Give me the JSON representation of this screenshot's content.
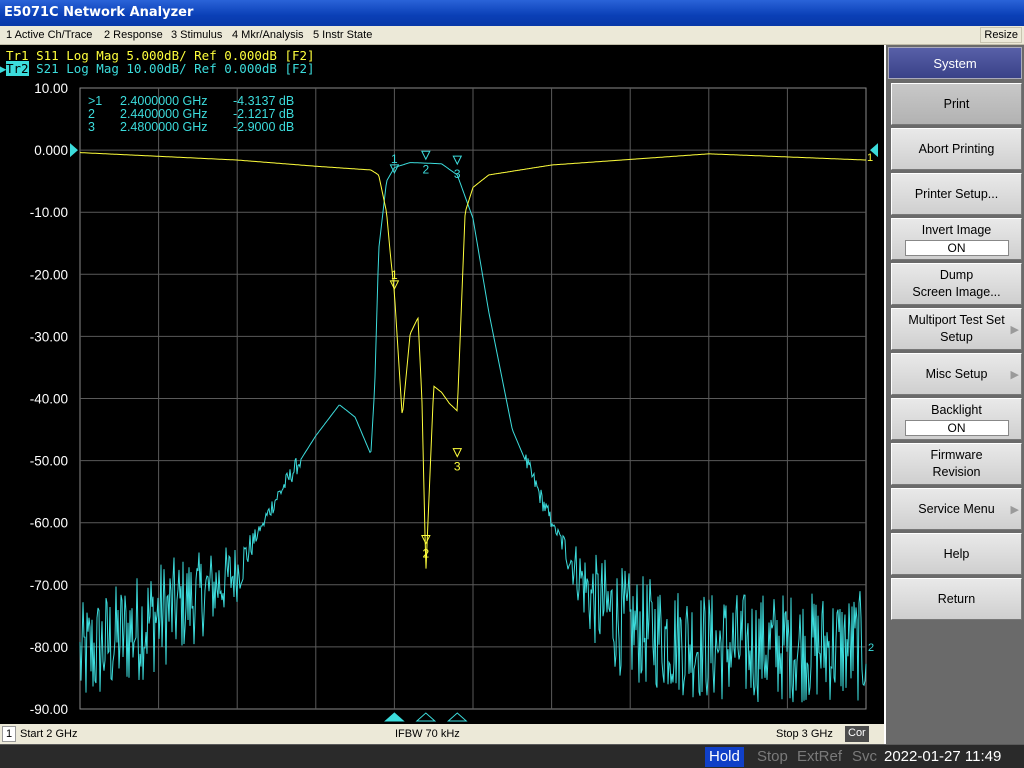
{
  "window": {
    "title": "E5071C Network Analyzer"
  },
  "menu": {
    "items": [
      "1 Active Ch/Trace",
      "2 Response",
      "3 Stimulus",
      "4 Mkr/Analysis",
      "5 Instr State"
    ],
    "resize": "Resize"
  },
  "traces": {
    "tr1": "Tr1 S11 Log Mag 5.000dB/ Ref 0.000dB [F2]",
    "tr2_tag": "Tr2",
    "tr2_rest": " S21 Log Mag 10.00dB/ Ref 0.000dB [F2]",
    "tr1_color": "#ffff3c",
    "tr2_color": "#3cdcdc"
  },
  "markers_table": [
    {
      "prefix": ">1",
      "freq": "2.4000000 GHz",
      "value": "-4.3137 dB"
    },
    {
      "prefix": " 2",
      "freq": "2.4400000 GHz",
      "value": "-2.1217 dB"
    },
    {
      "prefix": " 3",
      "freq": "2.4800000 GHz",
      "value": "-2.9000 dB"
    }
  ],
  "y_ticks": [
    "10.00",
    "0.000",
    "-10.00",
    "-20.00",
    "-30.00",
    "-40.00",
    "-50.00",
    "-60.00",
    "-70.00",
    "-80.00",
    "-90.00"
  ],
  "chart_data": {
    "type": "line",
    "x_unit": "GHz",
    "xlim": [
      2.0,
      3.0
    ],
    "ylim": [
      -90,
      10
    ],
    "y_scale_note": "graticule labels use S21 scale 10 dB/div, ref 0 dB",
    "grid": true,
    "series": [
      {
        "name": "S11",
        "scale_db_per_div": 5.0,
        "ref_db": 0.0,
        "color": "#ffff3c",
        "x": [
          2.0,
          2.1,
          2.2,
          2.3,
          2.37,
          2.38,
          2.39,
          2.395,
          2.4,
          2.41,
          2.42,
          2.43,
          2.435,
          2.44,
          2.45,
          2.46,
          2.47,
          2.48,
          2.49,
          2.5,
          2.52,
          2.6,
          2.8,
          3.0
        ],
        "y": [
          -0.2,
          -0.5,
          -0.8,
          -1.3,
          -1.6,
          -2.0,
          -5.0,
          -8.5,
          -11.5,
          -21.5,
          -14.8,
          -13.5,
          -20.0,
          -34.0,
          -19.0,
          -19.5,
          -20.4,
          -21.0,
          -5.0,
          -3.0,
          -2.0,
          -1.2,
          -0.3,
          -0.8
        ]
      },
      {
        "name": "S21",
        "scale_db_per_div": 10.0,
        "ref_db": 0.0,
        "color": "#3cdcdc",
        "x": [
          2.0,
          2.1,
          2.15,
          2.2,
          2.25,
          2.3,
          2.33,
          2.35,
          2.37,
          2.375,
          2.38,
          2.39,
          2.4,
          2.42,
          2.44,
          2.46,
          2.48,
          2.5,
          2.52,
          2.55,
          2.6,
          2.65,
          2.7,
          2.8,
          2.9,
          3.0
        ],
        "y": [
          -82,
          -75,
          -72,
          -68,
          -56,
          -46,
          -41,
          -43,
          -49,
          -38,
          -16,
          -5,
          -2.8,
          -2.0,
          -2.1,
          -2.2,
          -4.0,
          -11.0,
          -26.0,
          -45.0,
          -60.0,
          -72.0,
          -77.0,
          -80.0,
          -80.0,
          -80.0
        ],
        "noise_floor_db": -80
      }
    ],
    "markers": [
      {
        "id": "1",
        "x": 2.4,
        "s21": -4.3137,
        "s11": -11.5
      },
      {
        "id": "2",
        "x": 2.44,
        "s21": -2.1217,
        "s11": -32.0
      },
      {
        "id": "3",
        "x": 2.48,
        "s21": -2.9,
        "s11": -25.0
      }
    ]
  },
  "channel_bar": {
    "channel": "1",
    "start": "Start 2 GHz",
    "ifbw": "IFBW 70 kHz",
    "stop": "Stop 3 GHz",
    "cor": "Cor"
  },
  "status_bar": {
    "hold": "Hold",
    "stop": "Stop",
    "extref": "ExtRef",
    "svc": "Svc",
    "datetime": "2022-01-27 11:49"
  },
  "softkeys": {
    "title": "System",
    "print": "Print",
    "abort_printing": "Abort Printing",
    "printer_setup": "Printer Setup...",
    "invert_image": "Invert Image",
    "invert_image_value": "ON",
    "dump_line1": "Dump",
    "dump_line2": "Screen Image...",
    "multiport_line1": "Multiport Test Set",
    "multiport_line2": "Setup",
    "misc_setup": "Misc Setup",
    "backlight": "Backlight",
    "backlight_value": "ON",
    "firmware_line1": "Firmware",
    "firmware_line2": "Revision",
    "service_menu": "Service Menu",
    "help": "Help",
    "return": "Return"
  }
}
